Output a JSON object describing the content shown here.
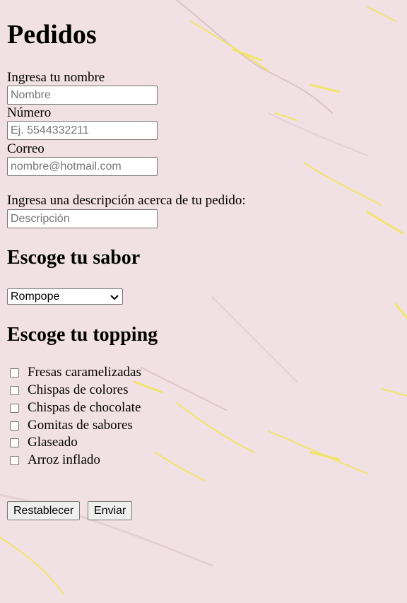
{
  "title": "Pedidos",
  "form": {
    "name_label": "Ingresa tu nombre",
    "name_placeholder": "Nombre",
    "phone_label": "Número",
    "phone_placeholder": "Ej. 5544332211",
    "email_label": "Correo",
    "email_placeholder": "nombre@hotmail.com",
    "description_label": "Ingresa una descripción acerca de tu pedido:",
    "description_placeholder": "Descripción"
  },
  "flavor": {
    "heading": "Escoge tu sabor",
    "selected": "Rompope"
  },
  "topping": {
    "heading": "Escoge tu topping",
    "options": [
      {
        "label": "Fresas caramelizadas",
        "checked": false
      },
      {
        "label": "Chispas de colores",
        "checked": false
      },
      {
        "label": "Chispas de chocolate",
        "checked": false
      },
      {
        "label": "Gomitas de sabores",
        "checked": false
      },
      {
        "label": "Glaseado",
        "checked": false
      },
      {
        "label": "Arroz inflado",
        "checked": false
      }
    ]
  },
  "buttons": {
    "reset": "Restablecer",
    "submit": "Enviar"
  },
  "colors": {
    "background": "#f1e1e4",
    "vein_gold": "#f2e46a"
  }
}
